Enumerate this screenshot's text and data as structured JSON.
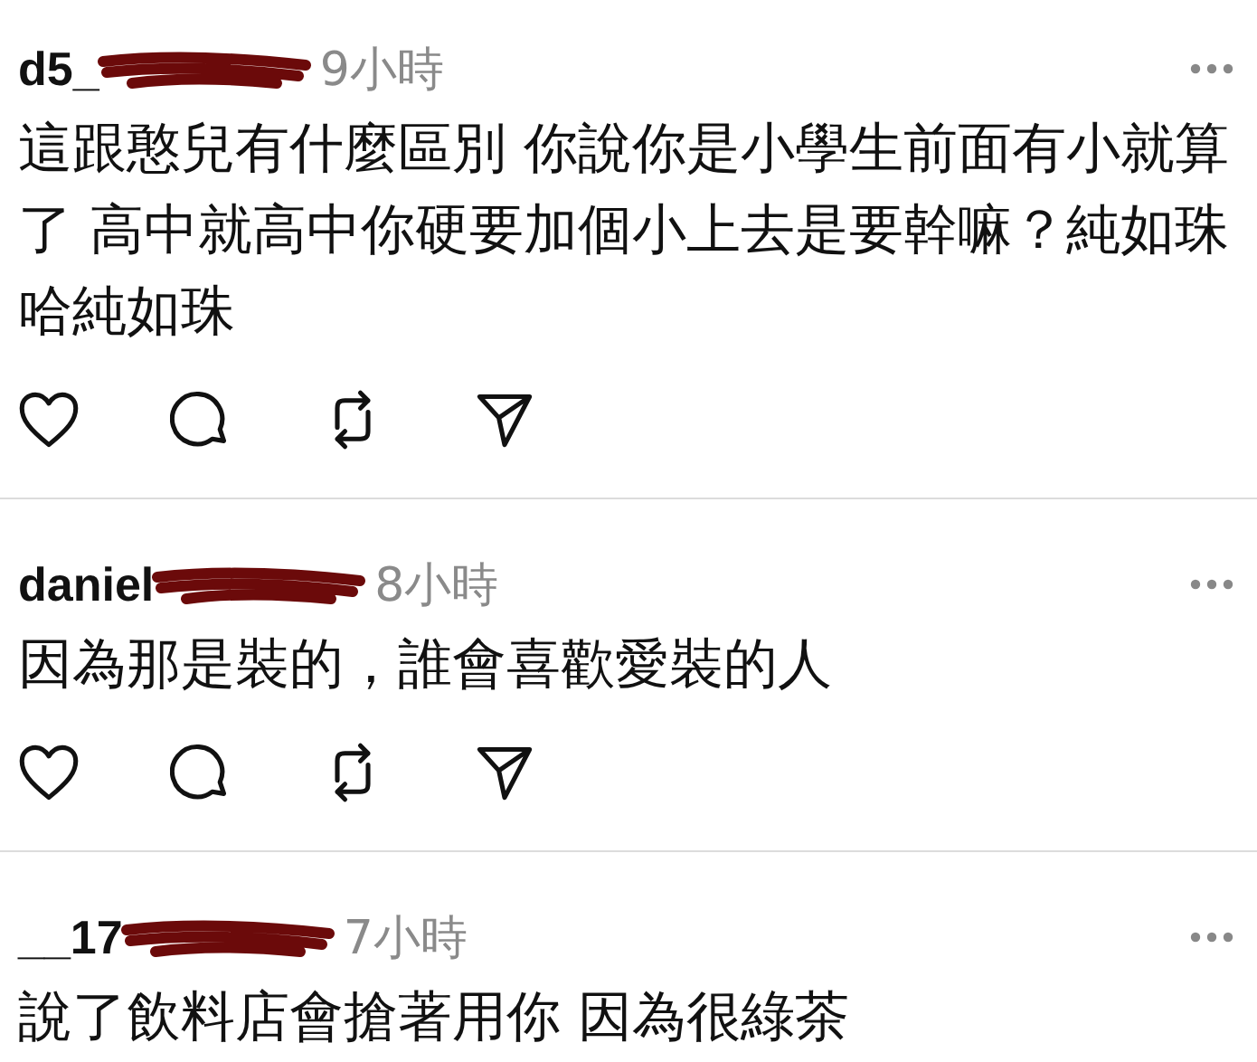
{
  "comments": [
    {
      "username": "d5_",
      "redacted": true,
      "time": "9小時",
      "text": "這跟憨兒有什麼區別 你說你是小學生前面有小就算了 高中就高中你硬要加個小上去是要幹嘛？純如珠哈純如珠",
      "actions_visible": true
    },
    {
      "username": "daniel",
      "redacted": true,
      "time": "8小時",
      "text": "因為那是裝的，誰會喜歡愛裝的人",
      "actions_visible": true
    },
    {
      "username": "__17",
      "redacted": true,
      "time": "7小時",
      "text": "說了飲料店會搶著用你 因為很綠茶",
      "actions_visible": false
    }
  ]
}
